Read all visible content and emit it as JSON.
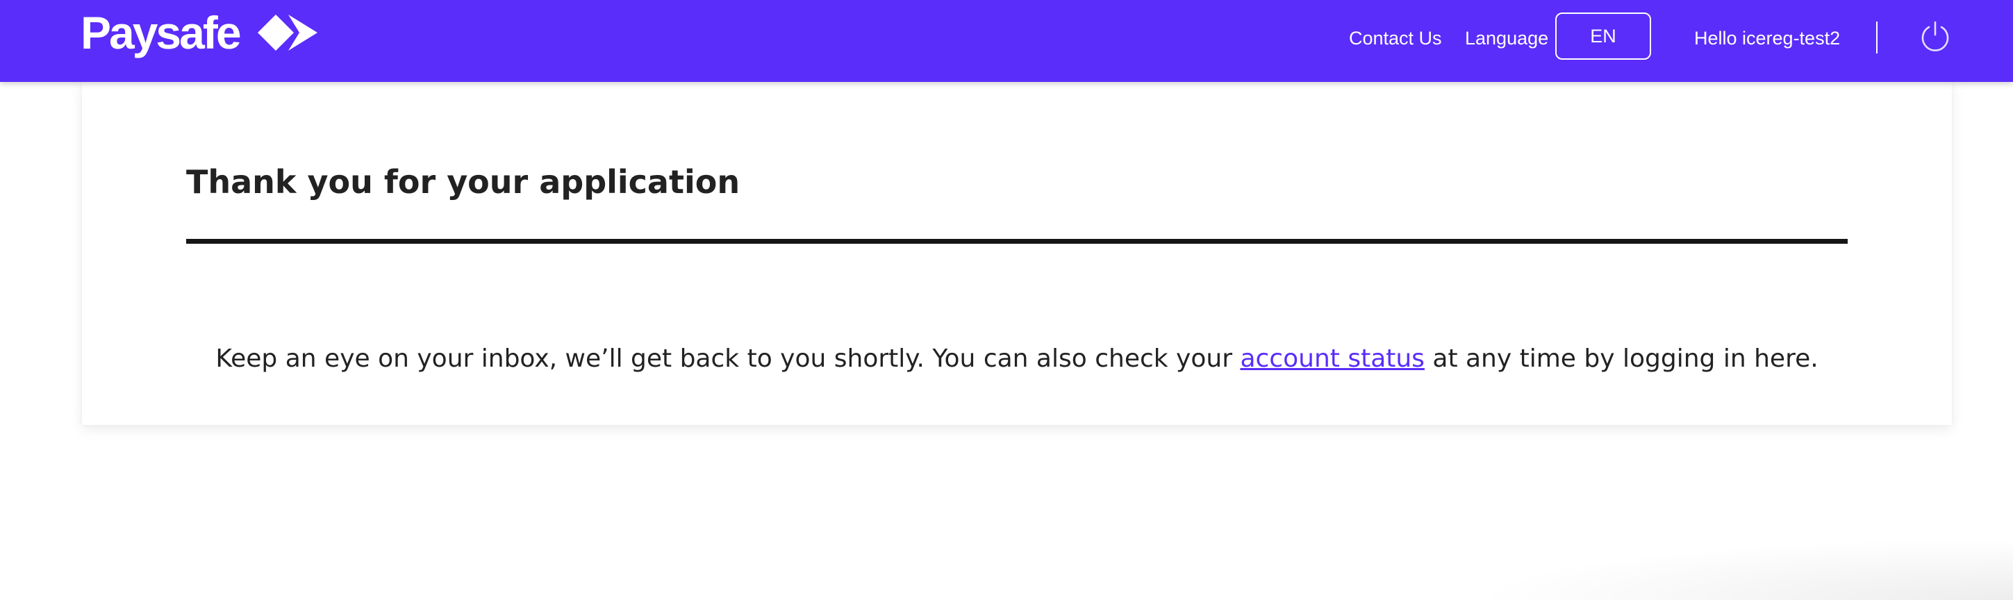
{
  "header": {
    "logo_text": "Paysafe",
    "contact_label": "Contact Us",
    "language_label": "Language",
    "language_value": "EN",
    "greeting": "Hello icereg-test2",
    "brand_color": "#5a2dfa",
    "icons": [
      "paysafe-diamonds-logo-icon",
      "power-icon"
    ]
  },
  "main": {
    "title": "Thank you for your application",
    "message_before": "Keep an eye on your inbox, we’ll get back to you shortly. You can also check your ",
    "link_text": "account status",
    "message_after": " at any time by logging in here."
  }
}
